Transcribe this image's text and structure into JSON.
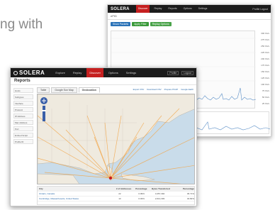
{
  "tagline": "ng with",
  "back_window": {
    "logo": "SOLERA",
    "tabs": [
      "Discover",
      "Replay",
      "Reports",
      "Options",
      "Settings"
    ],
    "active_tab": 0,
    "right_links": "Profile  Logout",
    "subtitle": "ePID",
    "buttons": [
      {
        "label": "Show Packets",
        "color": "#2b73b8"
      },
      {
        "label": "Apply Filter",
        "color": "#3a9a3a"
      },
      {
        "label": "Replay Options",
        "color": "#4aa34a"
      }
    ],
    "y_ticks": [
      "300 Kb/s",
      "275 Kb/s",
      "250 Kb/s",
      "225 Kb/s",
      "200 Kb/s",
      "175 Kb/s",
      "150 Kb/s",
      "125 Kb/s",
      "100 Kb/s",
      "75 Kb/s",
      "50 Kb/s",
      "25 Kb/s",
      "0 Kb/s"
    ]
  },
  "front_window": {
    "logo": "SOLERA",
    "tabs": [
      "Explore",
      "Replay",
      "Discover",
      "Options",
      "Settings"
    ],
    "active_tab": 2,
    "right_links": [
      "Profile",
      "Logout"
    ],
    "title": "Reports",
    "sidebar": [
      "Hosts",
      "Subtypes",
      "Interface",
      "Protocol",
      "IP Address",
      "Mac Address",
      "Port",
      "Embed Script",
      "Profile ID"
    ],
    "subtabs": [
      "Table",
      "Google Sun Map",
      "Geolocation"
    ],
    "active_subtab": 2,
    "links": [
      "Export CSV",
      "Download CSV",
      "Prepare PCAP",
      "Google Earth"
    ],
    "table_headers": [
      "City",
      "# of Addresses",
      "Percentage",
      "Bytes Transferred",
      "Percentage"
    ],
    "table_rows": [
      [
        "Ontario, Canada",
        "22",
        "0.09%",
        "3,457,394",
        "45.71%"
      ],
      [
        "Cambridge, Massachusetts, United States",
        "13",
        "0.03%",
        "2,614,303",
        "34.82%"
      ]
    ]
  }
}
